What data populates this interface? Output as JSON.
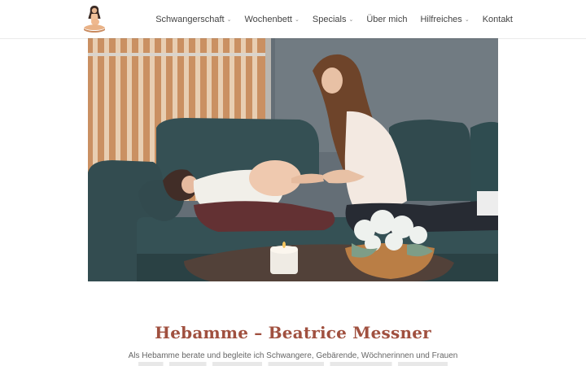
{
  "header": {
    "nav": [
      {
        "label": "Schwangerschaft",
        "has_dropdown": true
      },
      {
        "label": "Wochenbett",
        "has_dropdown": true
      },
      {
        "label": "Specials",
        "has_dropdown": true
      },
      {
        "label": "Über mich",
        "has_dropdown": false
      },
      {
        "label": "Hilfreiches",
        "has_dropdown": true
      },
      {
        "label": "Kontakt",
        "has_dropdown": false
      }
    ],
    "dropdown_icon": "chevron-down-icon"
  },
  "main": {
    "hero_image": "photo-midwife-with-pregnant-woman",
    "title": "Hebamme – Beatrice Messner",
    "intro": "Als Hebamme berate und begleite ich Schwangere, Gebärende, Wöchnerinnen und Frauen"
  },
  "colors": {
    "title": "#a0503f",
    "nav_text": "#444444",
    "body_text": "#666666"
  }
}
